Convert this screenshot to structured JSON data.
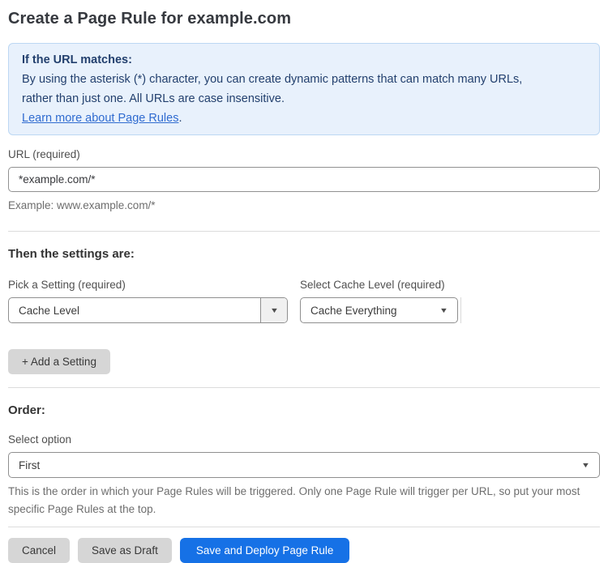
{
  "page": {
    "title": "Create a Page Rule for example.com"
  },
  "info_banner": {
    "heading": "If the URL matches:",
    "body_line1": "By using the asterisk (*) character, you can create dynamic patterns that can match many URLs,",
    "body_line2": "rather than just one. All URLs are case insensitive.",
    "link_label": "Learn more about Page Rules",
    "link_suffix": "."
  },
  "url_field": {
    "label": "URL (required)",
    "value": "*example.com/*",
    "example": "Example: www.example.com/*"
  },
  "settings": {
    "heading": "Then the settings are:",
    "pick_setting": {
      "label": "Pick a Setting (required)",
      "value": "Cache Level"
    },
    "cache_level": {
      "label": "Select Cache Level (required)",
      "value": "Cache Everything"
    },
    "add_button_label": "+ Add a Setting"
  },
  "order": {
    "heading": "Order:",
    "label": "Select option",
    "value": "First",
    "help": "This is the order in which your Page Rules will be triggered. Only one Page Rule will trigger per URL, so put your most specific Page Rules at the top."
  },
  "actions": {
    "cancel_label": "Cancel",
    "save_draft_label": "Save as Draft",
    "save_deploy_label": "Save and Deploy Page Rule"
  },
  "icons": {
    "dropdown_arrow": "▼"
  },
  "colors": {
    "info_banner_bg": "#e8f1fc",
    "info_banner_border": "#bcd7f3",
    "info_banner_text": "#23406e",
    "link_blue": "#2f6bd0",
    "primary_button_blue": "#1671e6",
    "secondary_button_gray": "#d6d6d6"
  }
}
